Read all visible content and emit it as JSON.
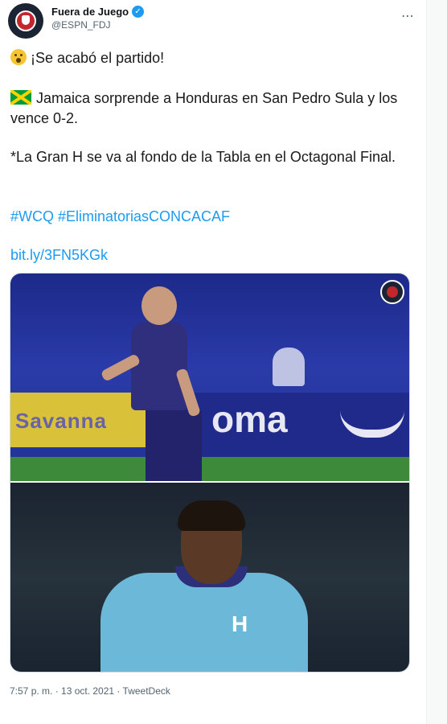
{
  "account": {
    "display_name": "Fuera de Juego",
    "handle": "@ESPN_FDJ",
    "verified": true,
    "avatar_icon": "espn-fdj-logo-icon"
  },
  "tweet": {
    "line1": "¡Se acabó el partido!",
    "line1_emoji": "astonished-face-icon",
    "line2": "Jamaica sorprende a Honduras en San Pedro Sula y los vence 0-2.",
    "line2_emoji": "jamaica-flag-icon",
    "line3": "*La Gran H se va al fondo de la Tabla en el Octagonal Final.",
    "hashtags": "#WCQ #EliminatoriasCONCACAF",
    "link": "bit.ly/3FN5KGk"
  },
  "media": {
    "photo_top": {
      "ad_left_text": "Savanna",
      "ad_right_text": "oma"
    },
    "photo_bottom": {
      "crest_text": "H"
    },
    "watermark_icon": "espn-fdj-logo-icon"
  },
  "meta": {
    "timestamp": "7:57 p. m. · 13 oct. 2021 · TweetDeck"
  },
  "colors": {
    "link": "#1d9bf0",
    "verified": "#1d9bf0",
    "text_secondary": "#536471"
  }
}
